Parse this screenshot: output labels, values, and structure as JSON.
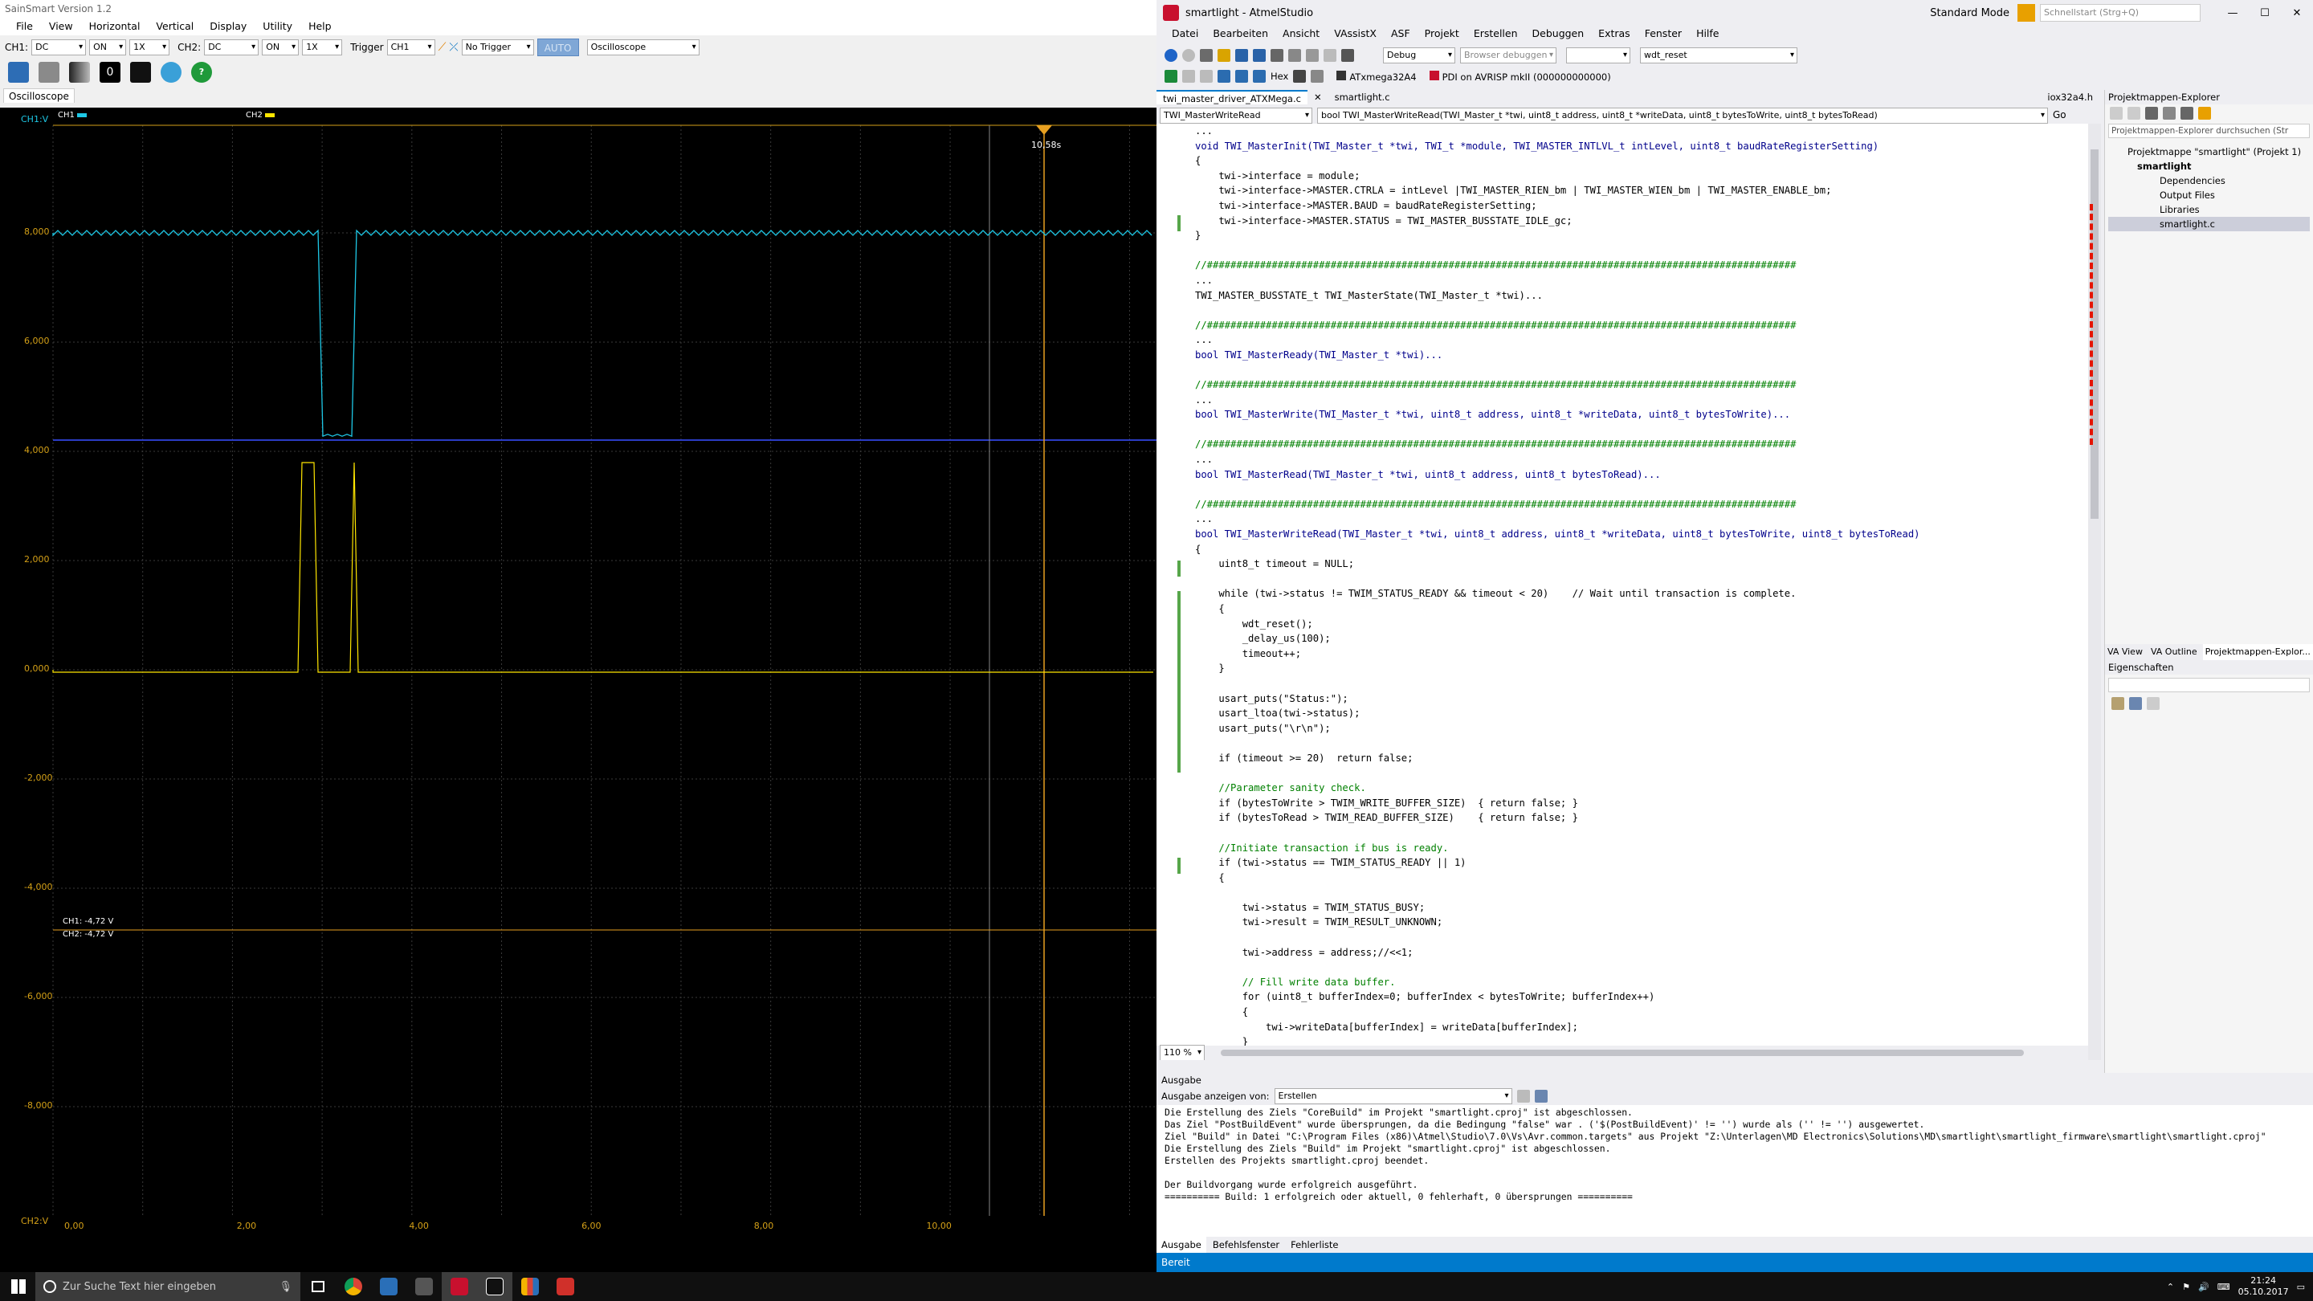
{
  "scope": {
    "title": "SainSmart  Version 1.2",
    "menu": [
      "File",
      "View",
      "Horizontal",
      "Vertical",
      "Display",
      "Utility",
      "Help"
    ],
    "ch1_label": "CH1:",
    "ch1_coupling": "DC",
    "ch1_on": "ON",
    "ch1_probe": "1X",
    "ch2_label": "CH2:",
    "ch2_coupling": "DC",
    "ch2_on": "ON",
    "ch2_probe": "1X",
    "trigger_label": "Trigger",
    "trigger_source": "CH1",
    "trigger_mode": "No Trigger",
    "auto": "AUTO",
    "mode": "Oscilloscope",
    "counter": "0",
    "tab": "Oscilloscope",
    "ch1_header": "CH1:V",
    "ch1_tag": "CH1",
    "ch2_tag": "CH2",
    "cursor_time": "10,58s",
    "ch1_cursor": "CH1: -4,72 V",
    "ch2_cursor": "CH2: -4,72 V",
    "bottom_label": "CH2:V",
    "y_ticks": [
      "8,000",
      "6,000",
      "4,000",
      "2,000",
      "0,000",
      "-2,000",
      "-4,000",
      "-6,000",
      "-8,000"
    ],
    "x_ticks": [
      "0,00",
      "2,00",
      "4,00",
      "6,00",
      "8,00",
      "10,00"
    ],
    "colors": {
      "ch1": "#1ec8e6",
      "ch2": "#ffe600",
      "grid": "#3a3a3a",
      "cursor": "#e8a020"
    }
  },
  "vs": {
    "title": "smartlight - AtmelStudio",
    "mode": "Standard Mode",
    "quicklaunch": "Schnellstart (Strg+Q)",
    "menu": [
      "Datei",
      "Bearbeiten",
      "Ansicht",
      "VAssistX",
      "ASF",
      "Projekt",
      "Erstellen",
      "Debuggen",
      "Extras",
      "Fenster",
      "Hilfe"
    ],
    "config": "Debug",
    "browser": "Browser debuggen",
    "find": "wdt_reset",
    "device": "ATxmega32A4",
    "tool": "PDI on AVRISP mkII (000000000000)",
    "hex": "Hex",
    "tabs": [
      "twi_master_driver_ATXMega.c",
      "smartlight.c",
      "iox32a4.h"
    ],
    "nav_left": "TWI_MasterWriteRead",
    "nav_right": "bool TWI_MasterWriteRead(TWI_Master_t *twi, uint8_t address, uint8_t *writeData, uint8_t bytesToWrite, uint8_t bytesToRead)",
    "go": "Go",
    "zoom": "110 %",
    "code": [
      "...",
      "void TWI_MasterInit(TWI_Master_t *twi, TWI_t *module, TWI_MASTER_INTLVL_t intLevel, uint8_t baudRateRegisterSetting)",
      "{",
      "    twi->interface = module;",
      "    twi->interface->MASTER.CTRLA = intLevel |TWI_MASTER_RIEN_bm | TWI_MASTER_WIEN_bm | TWI_MASTER_ENABLE_bm;",
      "    twi->interface->MASTER.BAUD = baudRateRegisterSetting;",
      "    twi->interface->MASTER.STATUS = TWI_MASTER_BUSSTATE_IDLE_gc;",
      "}",
      "",
      "//####################################################################################################",
      "...",
      "TWI_MASTER_BUSSTATE_t TWI_MasterState(TWI_Master_t *twi)...",
      "",
      "//####################################################################################################",
      "...",
      "bool TWI_MasterReady(TWI_Master_t *twi)...",
      "",
      "//####################################################################################################",
      "...",
      "bool TWI_MasterWrite(TWI_Master_t *twi, uint8_t address, uint8_t *writeData, uint8_t bytesToWrite)...",
      "",
      "//####################################################################################################",
      "...",
      "bool TWI_MasterRead(TWI_Master_t *twi, uint8_t address, uint8_t bytesToRead)...",
      "",
      "//####################################################################################################",
      "...",
      "bool TWI_MasterWriteRead(TWI_Master_t *twi, uint8_t address, uint8_t *writeData, uint8_t bytesToWrite, uint8_t bytesToRead)",
      "{",
      "    uint8_t timeout = NULL;",
      "",
      "    while (twi->status != TWIM_STATUS_READY && timeout < 20)    // Wait until transaction is complete.",
      "    {",
      "        wdt_reset();",
      "        _delay_us(100);",
      "        timeout++;",
      "    }",
      "",
      "    usart_puts(\"Status:\");",
      "    usart_ltoa(twi->status);",
      "    usart_puts(\"\\r\\n\");",
      "",
      "    if (timeout >= 20)  return false;",
      "",
      "    //Parameter sanity check.",
      "    if (bytesToWrite > TWIM_WRITE_BUFFER_SIZE)  { return false; }",
      "    if (bytesToRead > TWIM_READ_BUFFER_SIZE)    { return false; }",
      "",
      "    //Initiate transaction if bus is ready.",
      "    if (twi->status == TWIM_STATUS_READY || 1)",
      "    {",
      "",
      "        twi->status = TWIM_STATUS_BUSY;",
      "        twi->result = TWIM_RESULT_UNKNOWN;",
      "",
      "        twi->address = address;//<<1;",
      "",
      "        // Fill write data buffer.",
      "        for (uint8_t bufferIndex=0; bufferIndex < bytesToWrite; bufferIndex++)",
      "        {",
      "            twi->writeData[bufferIndex] = writeData[bufferIndex];",
      "        }"
    ],
    "se_title": "Projektmappen-Explorer",
    "se_search": "Projektmappen-Explorer durchsuchen (Str",
    "se_tree": [
      "Projektmappe \"smartlight\" (Projekt 1)",
      "smartlight",
      "Dependencies",
      "Output Files",
      "Libraries",
      "smartlight.c"
    ],
    "se_tabs": [
      "VA View",
      "VA Outline",
      "Projektmappen-Explor..."
    ],
    "props_title": "Eigenschaften",
    "out_title": "Ausgabe",
    "out_show_label": "Ausgabe anzeigen von:",
    "out_source": "Erstellen",
    "out_lines": [
      "Die Erstellung des Ziels \"CoreBuild\" im Projekt \"smartlight.cproj\" ist abgeschlossen.",
      "Das Ziel \"PostBuildEvent\" wurde übersprungen, da die Bedingung \"false\" war . ('$(PostBuildEvent)' != '') wurde als ('' != '') ausgewertet.",
      "Ziel \"Build\" in Datei \"C:\\Program Files (x86)\\Atmel\\Studio\\7.0\\Vs\\Avr.common.targets\" aus Projekt \"Z:\\Unterlagen\\MD Electronics\\Solutions\\MD\\smartlight\\smartlight_firmware\\smartlight\\smartlight.cproj\"",
      "Die Erstellung des Ziels \"Build\" im Projekt \"smartlight.cproj\" ist abgeschlossen.",
      "Erstellen des Projekts smartlight.cproj beendet.",
      "",
      "Der Buildvorgang wurde erfolgreich ausgeführt.",
      "========== Build: 1 erfolgreich oder aktuell, 0 fehlerhaft, 0 übersprungen =========="
    ],
    "out_tabs": [
      "Ausgabe",
      "Befehlsfenster",
      "Fehlerliste"
    ],
    "status": "Bereit"
  },
  "taskbar": {
    "search": "Zur Suche Text hier eingeben",
    "time": "21:24",
    "date": "05.10.2017"
  }
}
